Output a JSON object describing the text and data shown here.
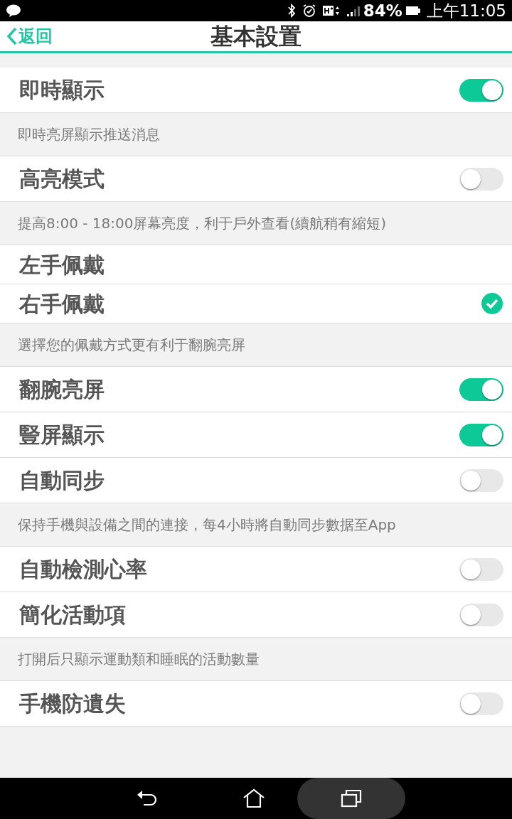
{
  "status_bar": {
    "battery": "84%",
    "time": "上午11:05"
  },
  "header": {
    "back": "返回",
    "title": "基本設置"
  },
  "items": [
    {
      "kind": "toggle",
      "label": "即時顯示",
      "on": true
    },
    {
      "kind": "note",
      "text": "即時亮屏顯示推送消息"
    },
    {
      "kind": "toggle",
      "label": "高亮模式",
      "on": false
    },
    {
      "kind": "note",
      "text": "提高8:00 - 18:00屏幕亮度，利于戶外查看(續航稍有縮短)"
    },
    {
      "kind": "choice",
      "label": "左手佩戴",
      "selected": false
    },
    {
      "kind": "choice",
      "label": "右手佩戴",
      "selected": true
    },
    {
      "kind": "note",
      "text": "選擇您的佩戴方式更有利于翻腕亮屏"
    },
    {
      "kind": "toggle",
      "label": "翻腕亮屏",
      "on": true
    },
    {
      "kind": "toggle",
      "label": "豎屏顯示",
      "on": true
    },
    {
      "kind": "toggle",
      "label": "自動同步",
      "on": false
    },
    {
      "kind": "note",
      "text": "保持手機與設備之間的連接，每4小時將自動同步數据至App"
    },
    {
      "kind": "toggle",
      "label": "自動檢測心率",
      "on": false
    },
    {
      "kind": "toggle",
      "label": "簡化活動項",
      "on": false
    },
    {
      "kind": "note",
      "text": "打開后只顯示運動類和睡眠的活動數量"
    },
    {
      "kind": "toggle",
      "label": "手機防遺失",
      "on": false
    }
  ]
}
